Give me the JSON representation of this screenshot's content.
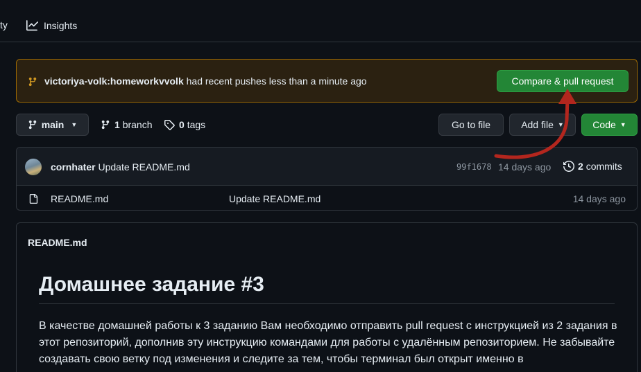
{
  "nav": {
    "activity_partial": "ty",
    "insights_label": "Insights"
  },
  "banner": {
    "branch": "victoriya-volk:homeworkvvolk",
    "message": " had recent pushes less than a minute ago",
    "button_label": "Compare & pull request"
  },
  "toolbar": {
    "branch_name": "main",
    "branch_count": "1",
    "branch_label": "branch",
    "tag_count": "0",
    "tag_label": "tags",
    "go_to_file": "Go to file",
    "add_file": "Add file",
    "code": "Code"
  },
  "latest_commit": {
    "author": "cornhater",
    "message": "Update README.md",
    "sha": "99f1678",
    "age": "14 days ago",
    "commit_count": "2",
    "commit_label": "commits"
  },
  "files": [
    {
      "name": "README.md",
      "message": "Update README.md",
      "age": "14 days ago"
    }
  ],
  "readme": {
    "file_title": "README.md",
    "heading": "Домашнее задание #3",
    "paragraph": "В качестве домашней работы к 3 заданию Вам необходимо отправить pull request с инструкцией из 2 задания в этот репозиторий, дополнив эту инструкцию командами для работы с удалённым репозиторием. Не забывайте создавать свою ветку под изменения и следите за тем, чтобы терминал был открыт именно в"
  },
  "colors": {
    "background": "#0d1117",
    "banner_bg": "#2b2111",
    "banner_border": "#9e6a03",
    "green": "#238636",
    "annotation_arrow": "#b3261e"
  }
}
